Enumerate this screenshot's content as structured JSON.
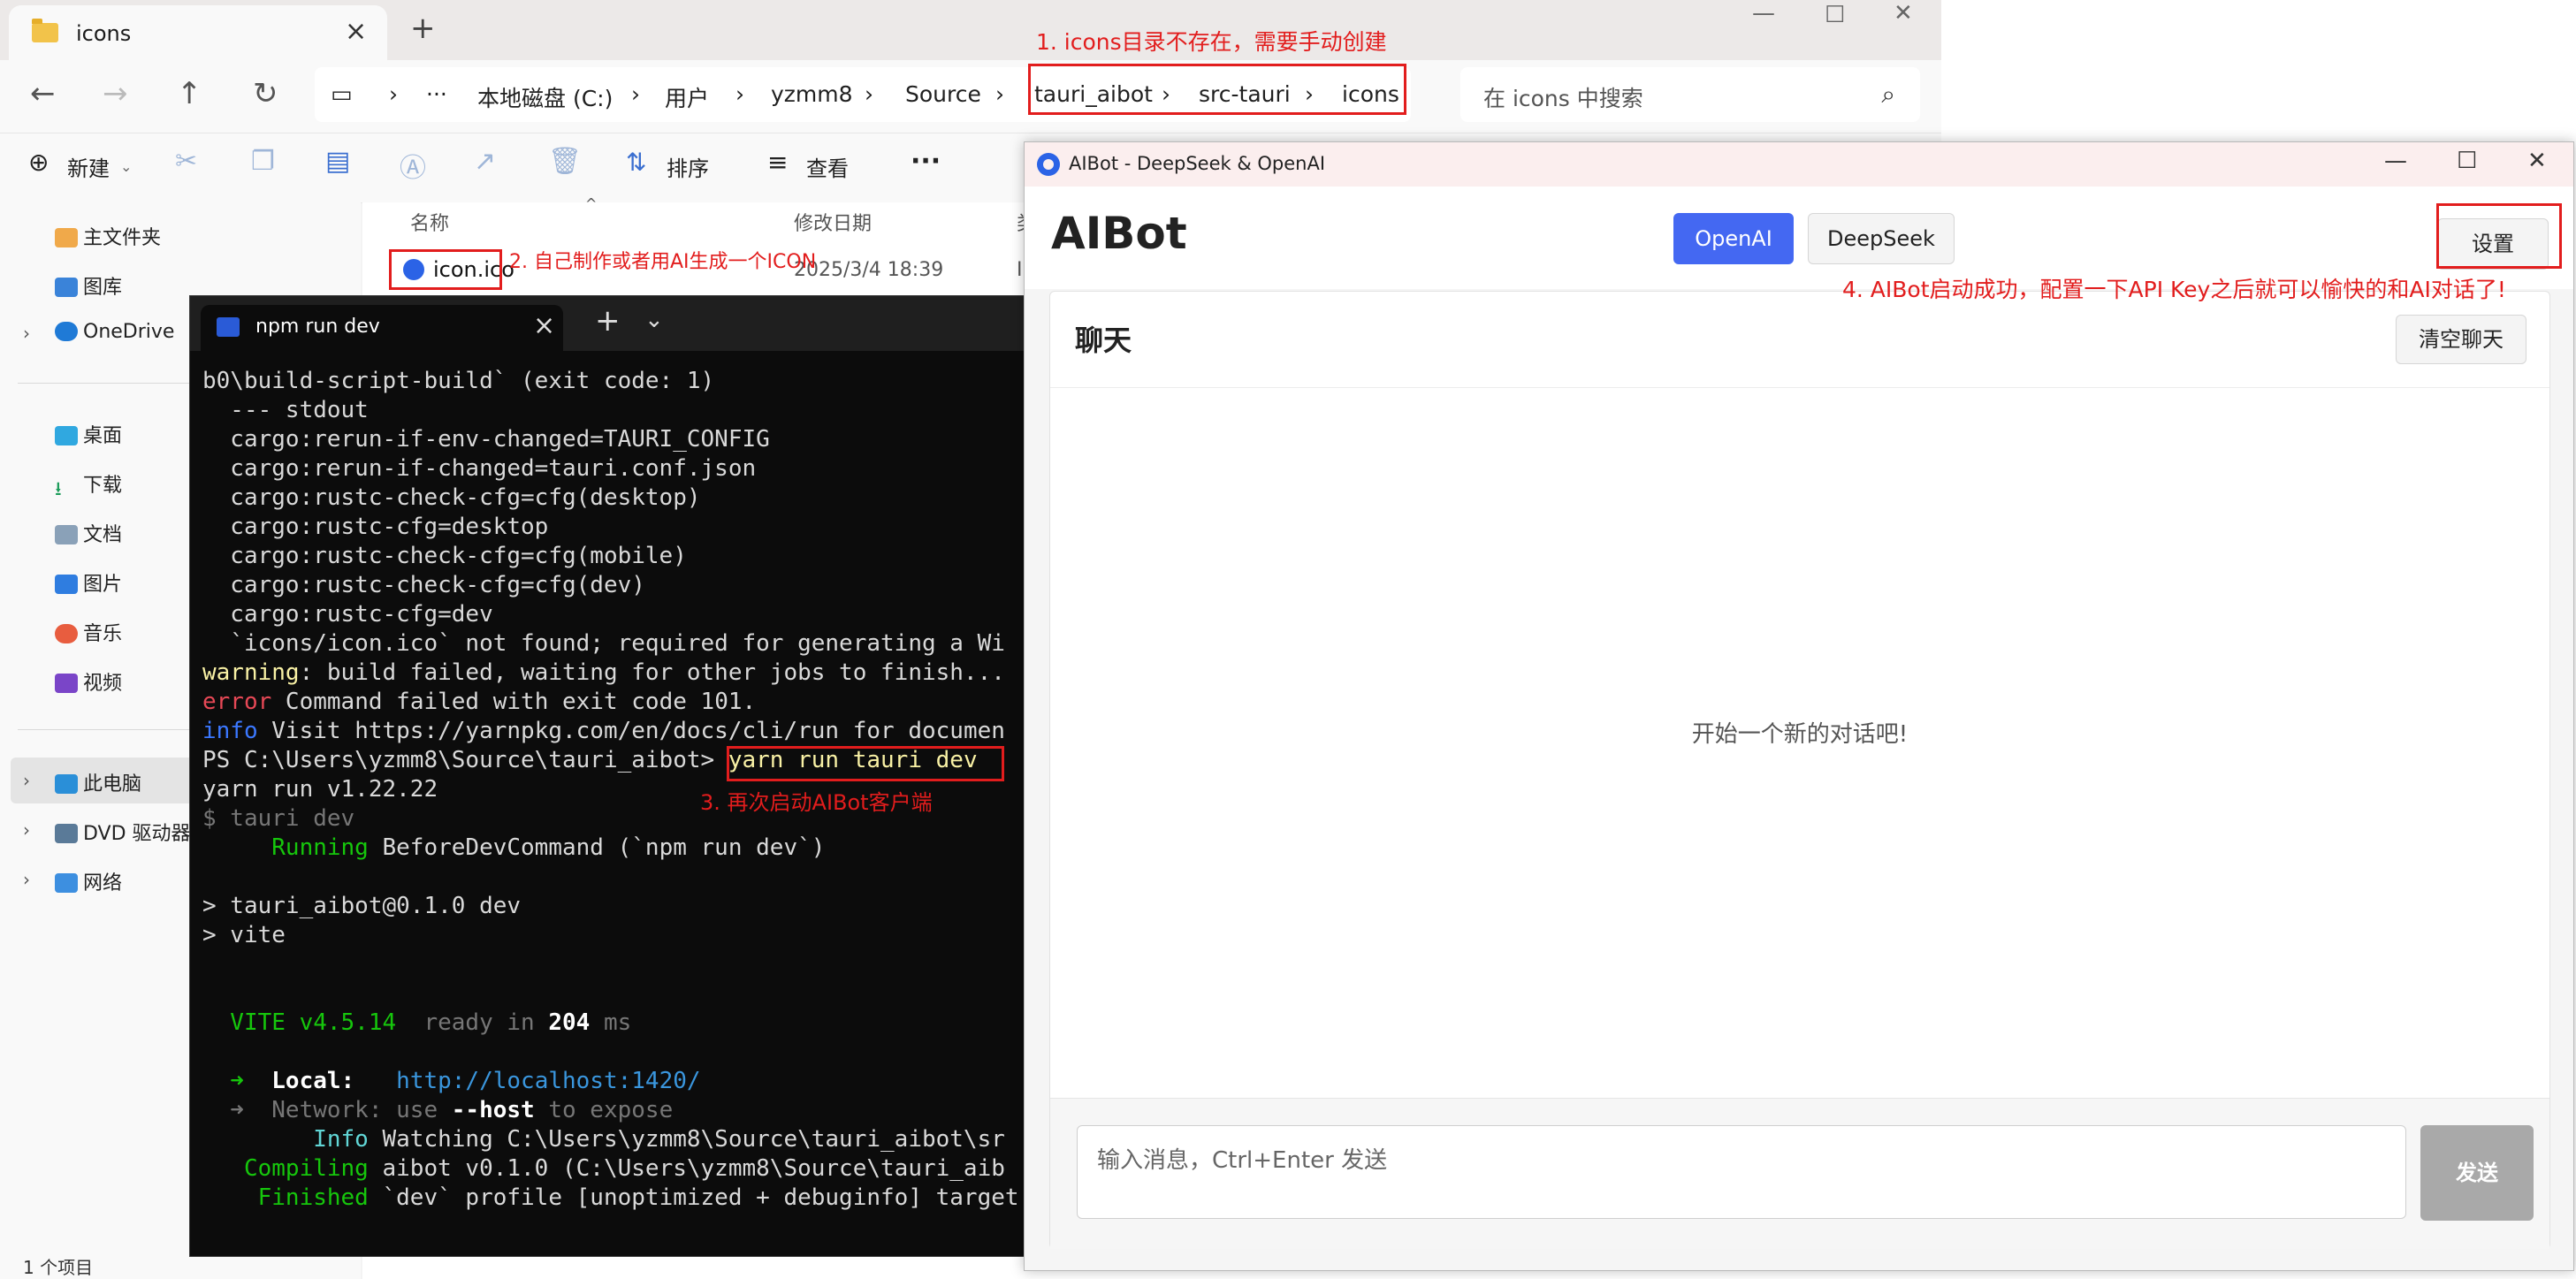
{
  "explorer": {
    "tab_title": "icons",
    "new_tab": "+",
    "address": [
      "本地磁盘 (C:)",
      "用户",
      "yzmm8",
      "Source",
      "tauri_aibot",
      "src-tauri",
      "icons"
    ],
    "ellipsis": "···",
    "search_placeholder": "在 icons 中搜索",
    "toolbar": {
      "new": "新建",
      "sort": "排序",
      "view": "查看",
      "more": "···"
    },
    "sidebar": {
      "home": "主文件夹",
      "gallery": "图库",
      "onedrive": "OneDrive",
      "desktop": "桌面",
      "downloads": "下载",
      "documents": "文档",
      "pictures": "图片",
      "music": "音乐",
      "videos": "视频",
      "thispc": "此电脑",
      "dvd": "DVD 驱动器",
      "network": "网络"
    },
    "columns": {
      "name": "名称",
      "date": "修改日期",
      "type": "类"
    },
    "file": {
      "name": "icon.ico",
      "date": "2025/3/4 18:39",
      "type": "I"
    },
    "status": "1 个项目"
  },
  "terminal": {
    "tab_title": "npm run dev",
    "lines": {
      "l1": "b0\\build-script-build` (exit code: 1)",
      "l2": "  --- stdout",
      "l3": "  cargo:rerun-if-env-changed=TAURI_CONFIG",
      "l4": "  cargo:rerun-if-changed=tauri.conf.json",
      "l5": "  cargo:rustc-check-cfg=cfg(desktop)",
      "l6": "  cargo:rustc-cfg=desktop",
      "l7": "  cargo:rustc-check-cfg=cfg(mobile)",
      "l8": "  cargo:rustc-check-cfg=cfg(dev)",
      "l9": "  cargo:rustc-cfg=dev",
      "l10": "  `icons/icon.ico` not found; required for generating a Wi",
      "l11a": "warning",
      "l11b": ": build failed, waiting for other jobs to finish...",
      "l12a": "error",
      "l12b": " Command failed with exit code 101.",
      "l13a": "info",
      "l13b": " Visit https://yarnpkg.com/en/docs/cli/run for documen",
      "l14a": "PS C:\\Users\\yzmm8\\Source\\tauri_aibot>",
      "l14b": " yarn run tauri dev",
      "l15": "yarn run v1.22.22",
      "l16": "$ tauri dev",
      "l17a": "     Running",
      "l17b": " BeforeDevCommand (`npm run dev`)",
      "l18": "> tauri_aibot@0.1.0 dev",
      "l19": "> vite",
      "l20a": "  VITE v4.5.14",
      "l20b": "  ready in ",
      "l20c": "204",
      "l20d": " ms",
      "l21a": "  ➜",
      "l21b": "  Local:",
      "l21c": "   http://localhost:1420/",
      "l22a": "  ➜  Network: use ",
      "l22b": "--host",
      "l22c": " to expose",
      "l23a": "        Info",
      "l23b": " Watching C:\\Users\\yzmm8\\Source\\tauri_aibot\\sr",
      "l24a": "   Compiling",
      "l24b": " aibot v0.1.0 (C:\\Users\\yzmm8\\Source\\tauri_aib",
      "l25a": "    Finished",
      "l25b": " `dev` profile [unoptimized + debuginfo] target"
    }
  },
  "aibot": {
    "window_title": "AIBot - DeepSeek & OpenAI",
    "app_name": "AIBot",
    "provider_openai": "OpenAI",
    "provider_deepseek": "DeepSeek",
    "settings": "设置",
    "chat_title": "聊天",
    "clear": "清空聊天",
    "empty": "开始一个新的对话吧!",
    "input_placeholder": "输入消息，Ctrl+Enter 发送",
    "send": "发送"
  },
  "annotations": {
    "a1": "1. icons目录不存在，需要手动创建",
    "a2": "2. 自己制作或者用AI生成一个ICON",
    "a3": "3. 再次启动AIBot客户端",
    "a4": "4. AIBot启动成功，配置一下API Key之后就可以愉快的和AI对话了!"
  },
  "colors": {
    "accent": "#4468f2",
    "annotation": "#e21d1d",
    "terminal_bg": "#0c0c0c"
  }
}
